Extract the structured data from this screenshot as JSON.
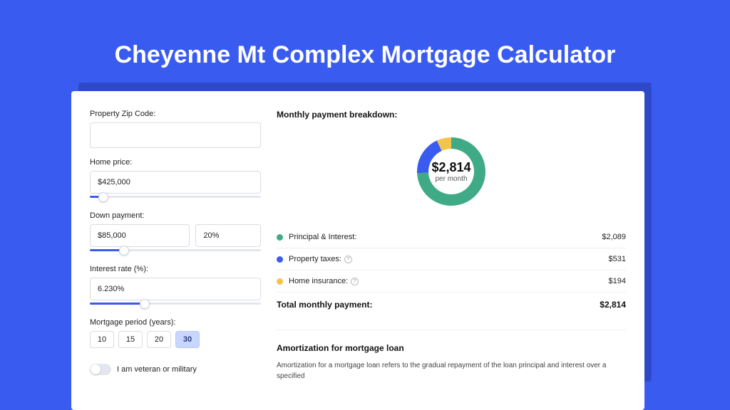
{
  "colors": {
    "pi": "#3fab86",
    "tax": "#3a5bf0",
    "ins": "#f3c44b"
  },
  "title": "Cheyenne Mt Complex Mortgage Calculator",
  "form": {
    "zip_label": "Property Zip Code:",
    "zip_value": "",
    "home_price_label": "Home price:",
    "home_price_value": "$425,000",
    "home_price_slider_pct": 8,
    "down_label": "Down payment:",
    "down_value": "$85,000",
    "down_pct_value": "20%",
    "down_slider_pct": 20,
    "rate_label": "Interest rate (%):",
    "rate_value": "6.230%",
    "rate_slider_pct": 32,
    "period_label": "Mortgage period (years):",
    "periods": [
      "10",
      "15",
      "20",
      "30"
    ],
    "period_selected": "30",
    "veteran_label": "I am veteran or military"
  },
  "breakdown": {
    "heading": "Monthly payment breakdown:",
    "center_amount": "$2,814",
    "center_sub": "per month",
    "items": [
      {
        "key": "pi",
        "label": "Principal & Interest:",
        "value": "$2,089",
        "info": false
      },
      {
        "key": "tax",
        "label": "Property taxes:",
        "value": "$531",
        "info": true
      },
      {
        "key": "ins",
        "label": "Home insurance:",
        "value": "$194",
        "info": true
      }
    ],
    "total_label": "Total monthly payment:",
    "total_value": "$2,814"
  },
  "amortization": {
    "heading": "Amortization for mortgage loan",
    "body": "Amortization for a mortgage loan refers to the gradual repayment of the loan principal and interest over a specified"
  },
  "chart_data": {
    "type": "pie",
    "title": "Monthly payment breakdown",
    "series": [
      {
        "name": "Principal & Interest",
        "value": 2089,
        "color": "#3fab86"
      },
      {
        "name": "Property taxes",
        "value": 531,
        "color": "#3a5bf0"
      },
      {
        "name": "Home insurance",
        "value": 194,
        "color": "#f3c44b"
      }
    ],
    "total": 2814,
    "unit": "USD/month",
    "donut": true
  }
}
